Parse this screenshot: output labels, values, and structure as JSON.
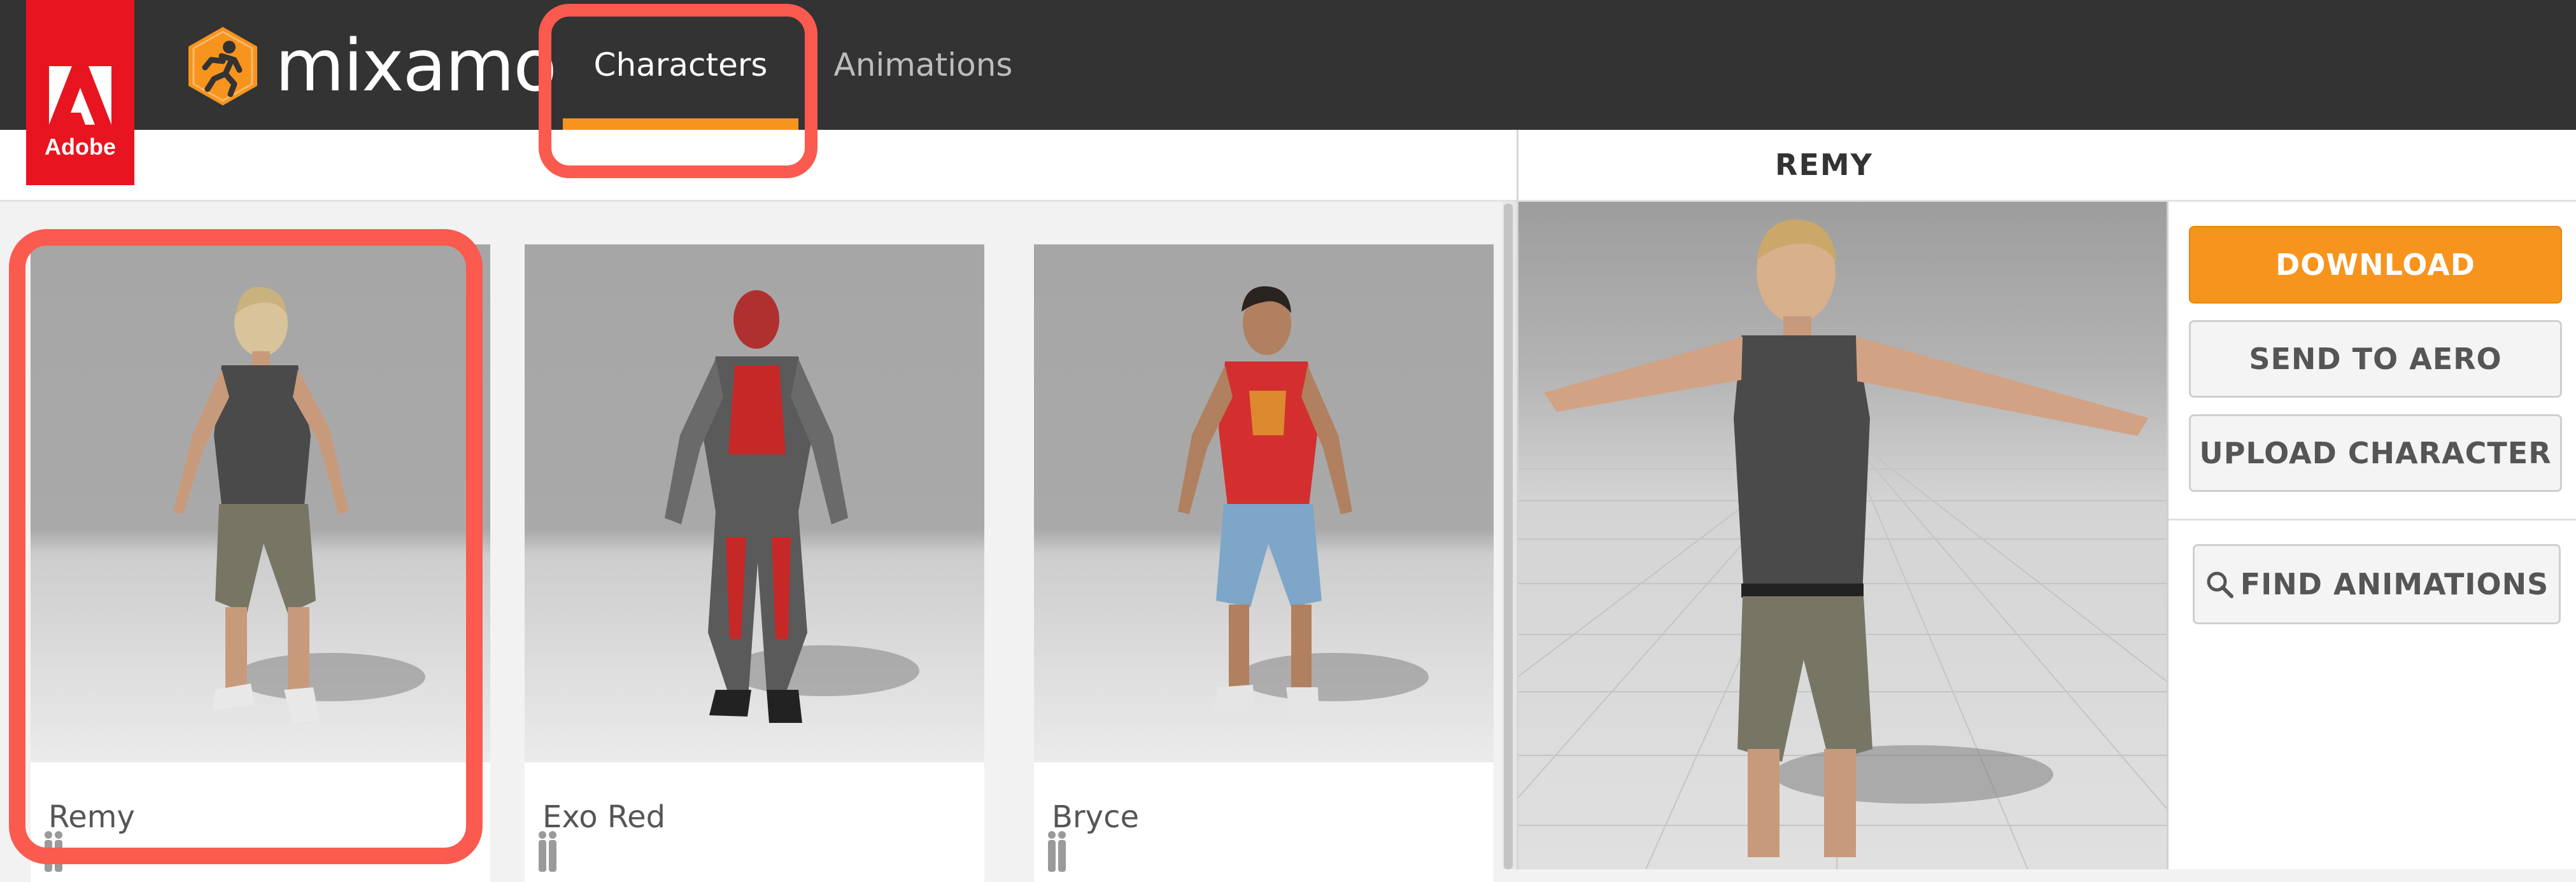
{
  "brand": {
    "adobe": "Adobe",
    "name": "mixamo"
  },
  "nav": {
    "tabs": [
      {
        "label": "Characters",
        "active": true
      },
      {
        "label": "Animations",
        "active": false
      }
    ]
  },
  "selected_character": "REMY",
  "characters": [
    {
      "name": "Remy",
      "selected": true
    },
    {
      "name": "Exo Red",
      "selected": false
    },
    {
      "name": "Bryce",
      "selected": false
    }
  ],
  "actions": {
    "download": "DOWNLOAD",
    "send_to_aero": "SEND TO AERO",
    "upload_character": "UPLOAD CHARACTER",
    "find_animations": "FIND ANIMATIONS"
  },
  "colors": {
    "accent": "#f7941d",
    "highlight": "#fb5a4f",
    "adobe_red": "#e8141f",
    "nav_bg": "#333333"
  },
  "icons": [
    "adobe-logo",
    "mixamo-runner-logo",
    "rig-figures-icon",
    "search-icon"
  ]
}
